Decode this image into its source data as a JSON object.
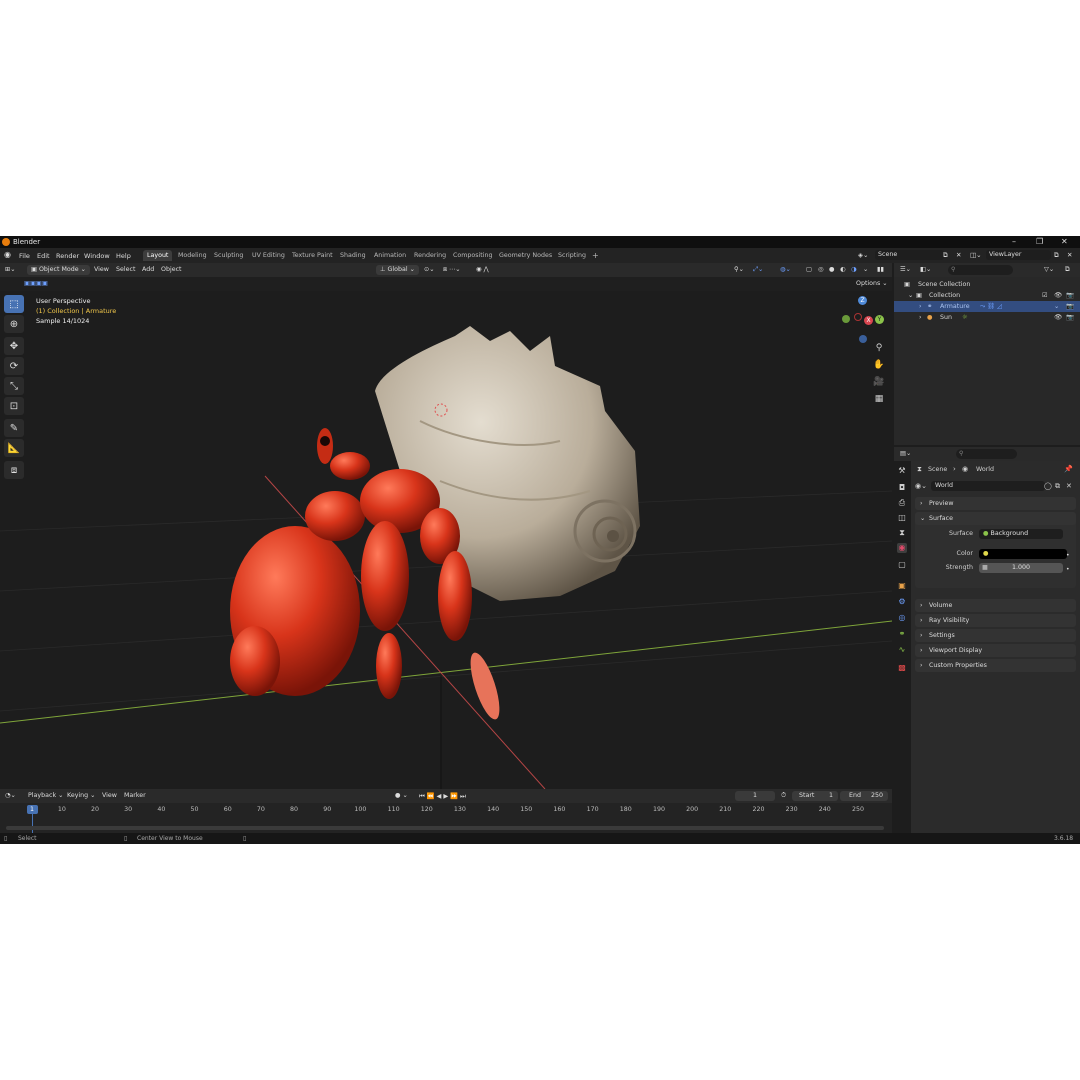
{
  "window": {
    "title": "Blender"
  },
  "menu": [
    "File",
    "Edit",
    "Render",
    "Window",
    "Help"
  ],
  "workspaces": [
    {
      "label": "Layout",
      "active": true
    },
    {
      "label": "Modeling"
    },
    {
      "label": "Sculpting"
    },
    {
      "label": "UV Editing"
    },
    {
      "label": "Texture Paint"
    },
    {
      "label": "Shading"
    },
    {
      "label": "Animation"
    },
    {
      "label": "Rendering"
    },
    {
      "label": "Compositing"
    },
    {
      "label": "Geometry Nodes"
    },
    {
      "label": "Scripting"
    }
  ],
  "add_workspace": "+",
  "scene": {
    "name": "Scene",
    "view_layer": "ViewLayer"
  },
  "header3d": {
    "mode": "Object Mode",
    "menus": [
      "View",
      "Select",
      "Add",
      "Object"
    ],
    "transform_orientation": "Global",
    "options": "Options"
  },
  "viewport": {
    "view_name": "User Perspective",
    "collection_prefix": "(1) Collection | ",
    "active_object": "Armature",
    "sample": "Sample 14/1024",
    "gizmo": {
      "z": "Z",
      "y": "Y",
      "x": "X"
    }
  },
  "timeline": {
    "menus": [
      "Playback",
      "Keying",
      "View",
      "Marker"
    ],
    "current_frame": "1",
    "start_label": "Start",
    "start": "1",
    "end_label": "End",
    "end": "250",
    "ticks": [
      "1",
      "10",
      "20",
      "30",
      "40",
      "50",
      "60",
      "70",
      "80",
      "90",
      "100",
      "110",
      "120",
      "130",
      "140",
      "150",
      "160",
      "170",
      "180",
      "190",
      "200",
      "210",
      "220",
      "230",
      "240",
      "250"
    ]
  },
  "statusbar": {
    "left": "Select",
    "middle": "Center View to Mouse",
    "version": "3.6.18"
  },
  "outliner": {
    "root": "Scene Collection",
    "items": [
      {
        "label": "Collection",
        "level": 1
      },
      {
        "label": "Armature",
        "level": 2,
        "selected": true
      },
      {
        "label": "Sun",
        "level": 2
      }
    ]
  },
  "properties": {
    "breadcrumb": [
      "Scene",
      "World"
    ],
    "world_name": "World",
    "panels": {
      "preview": "Preview",
      "surface": "Surface",
      "volume": "Volume",
      "ray_visibility": "Ray Visibility",
      "settings": "Settings",
      "viewport_display": "Viewport Display",
      "custom_properties": "Custom Properties"
    },
    "surface_label": "Surface",
    "surface_value": "Background",
    "color_label": "Color",
    "color_value": "#000000",
    "strength_label": "Strength",
    "strength_value": "1.000"
  },
  "colors": {
    "accent": "#4772b3",
    "selection": "#334d80",
    "crab_red": "#d63a1c",
    "shell": "#c9bfae",
    "x_axis": "#d8454f",
    "y_axis": "#8bc34a",
    "z_axis": "#4f8ad8"
  }
}
